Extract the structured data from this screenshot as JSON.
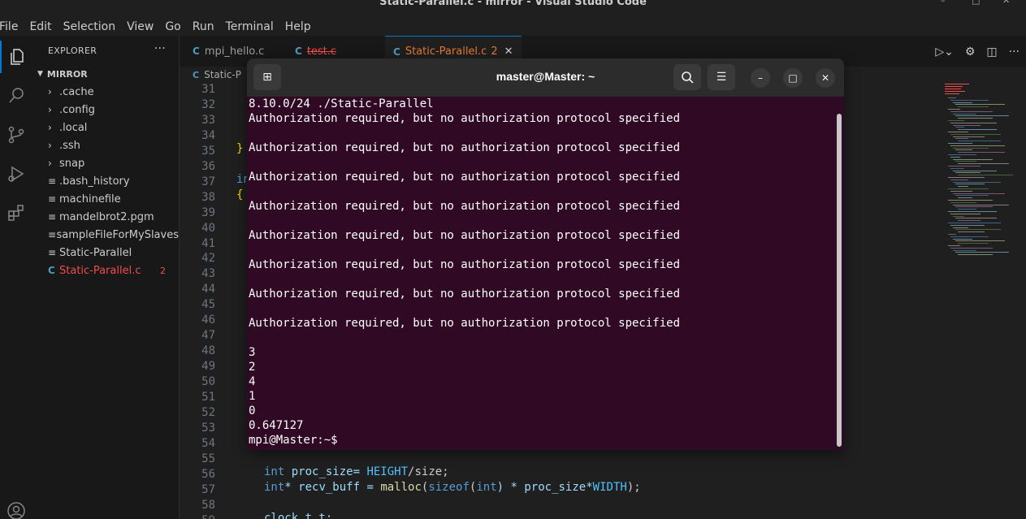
{
  "window": {
    "title": "Static-Parallel.c - mirror - Visual Studio Code"
  },
  "menu": [
    "File",
    "Edit",
    "Selection",
    "View",
    "Go",
    "Run",
    "Terminal",
    "Help"
  ],
  "activity_icons": [
    "files-icon",
    "search-icon",
    "source-control-icon",
    "run-debug-icon",
    "extensions-icon",
    "account-icon"
  ],
  "explorer": {
    "header": "EXPLORER",
    "root": "MIRROR",
    "items": [
      {
        "label": ".cache",
        "type": "folder"
      },
      {
        "label": ".config",
        "type": "folder"
      },
      {
        "label": ".local",
        "type": "folder"
      },
      {
        "label": ".ssh",
        "type": "folder"
      },
      {
        "label": "snap",
        "type": "folder"
      },
      {
        "label": ".bash_history",
        "type": "file"
      },
      {
        "label": "machinefile",
        "type": "file"
      },
      {
        "label": "mandelbrot2.pgm",
        "type": "file"
      },
      {
        "label": "sampleFileForMySlaves",
        "type": "file"
      },
      {
        "label": "Static-Parallel",
        "type": "file"
      },
      {
        "label": "Static-Parallel.c",
        "type": "c-file",
        "badge": "2"
      }
    ]
  },
  "tabs": [
    {
      "label": "mpi_hello.c"
    },
    {
      "label": "test.c"
    },
    {
      "label": "Static-Parallel.c",
      "badge": "2"
    }
  ],
  "breadcrumb": "Static-P",
  "editor": {
    "line_numbers": [
      "31",
      "32",
      "33",
      "34",
      "35",
      "36",
      "37",
      "38",
      "39",
      "40",
      "41",
      "42",
      "43",
      "44",
      "45",
      "46",
      "47",
      "48",
      "49",
      "50",
      "51",
      "52",
      "53",
      "54",
      "55",
      "56",
      "57",
      "58",
      "59"
    ],
    "visible_code": {
      "l35": "}",
      "l37": "in",
      "l38": "{",
      "l56_type": "int",
      "l56_rest": " proc_size= ",
      "l56_macro": "HEIGHT",
      "l56_end": "/size;",
      "l57_type": "int",
      "l57_a": "* recv_buff = ",
      "l57_fn": "malloc",
      "l57_b": "(",
      "l57_fn2": "sizeof",
      "l57_c": "(",
      "l57_kw": "int",
      "l57_d": ") * proc_size*",
      "l57_macro": "WIDTH",
      "l57_e": ");",
      "l59": "clock_t t;"
    }
  },
  "terminal": {
    "title": "master@Master: ~",
    "lines": [
      "8.10.0/24 ./Static-Parallel",
      "Authorization required, but no authorization protocol specified",
      "",
      "Authorization required, but no authorization protocol specified",
      "",
      "Authorization required, but no authorization protocol specified",
      "",
      "Authorization required, but no authorization protocol specified",
      "",
      "Authorization required, but no authorization protocol specified",
      "",
      "Authorization required, but no authorization protocol specified",
      "",
      "Authorization required, but no authorization protocol specified",
      "",
      "Authorization required, but no authorization protocol specified",
      "",
      "3",
      "2",
      "4",
      "1",
      "0",
      "0.647127",
      "mpi@Master:~$"
    ]
  },
  "colors": {
    "accent": "#0078d4",
    "error": "#f14c4c",
    "terminal_bg": "#300a24"
  }
}
